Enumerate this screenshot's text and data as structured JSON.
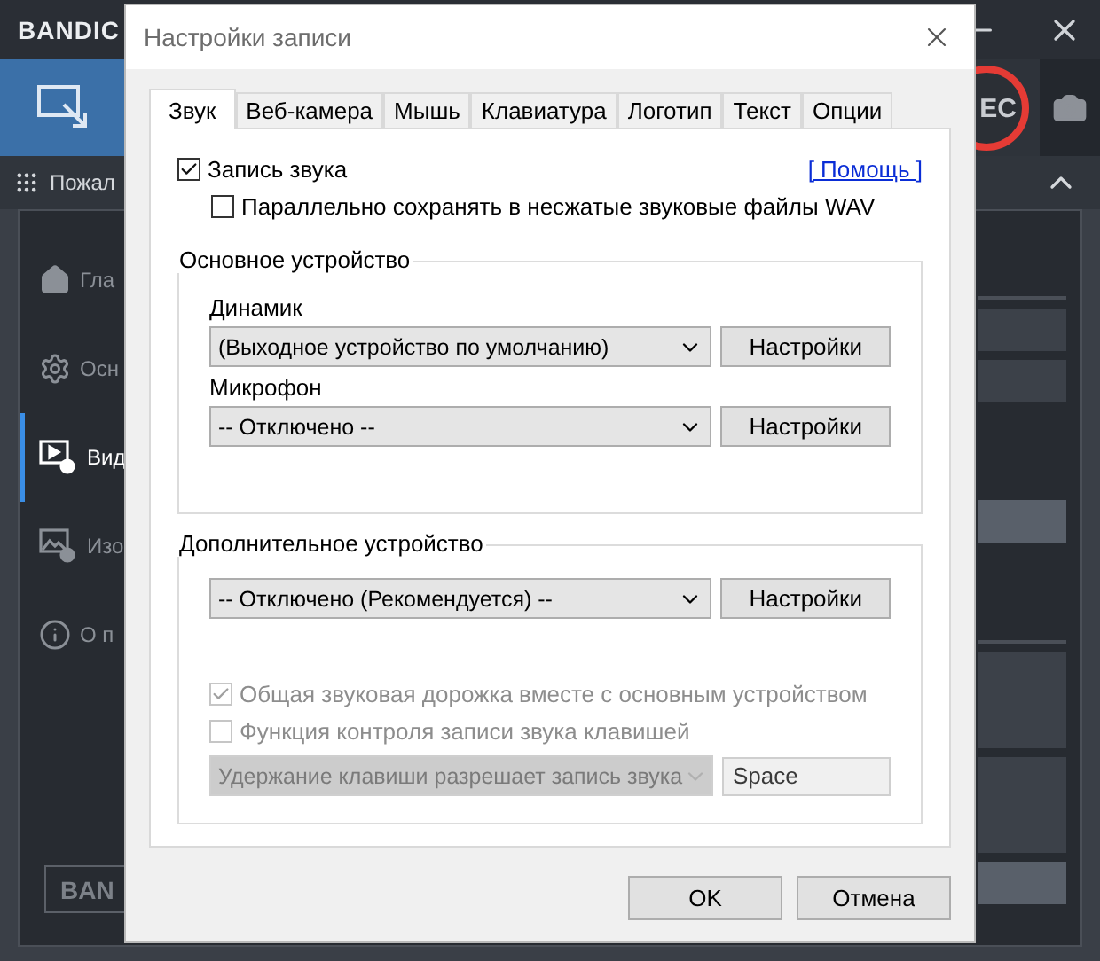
{
  "app": {
    "logo": "BANDIC",
    "rec_label": "EC",
    "section_title": "Пожал",
    "sidebar": [
      {
        "label": "Гла",
        "selected": false
      },
      {
        "label": "Осн",
        "selected": false
      },
      {
        "label": "Вид",
        "selected": true
      },
      {
        "label": "Изо",
        "selected": false
      },
      {
        "label": "О п",
        "selected": false
      }
    ],
    "bottom_button": "BAN"
  },
  "dialog": {
    "title": "Настройки записи",
    "tabs": [
      {
        "label": "Звук",
        "selected": true
      },
      {
        "label": "Веб-камера",
        "selected": false
      },
      {
        "label": "Мышь",
        "selected": false
      },
      {
        "label": "Клавиатура",
        "selected": false
      },
      {
        "label": "Логотип",
        "selected": false
      },
      {
        "label": "Текст",
        "selected": false
      },
      {
        "label": "Опции",
        "selected": false
      }
    ],
    "record_audio": {
      "label": "Запись звука",
      "checked": true
    },
    "help_link": "[ Помощь ]",
    "save_wav": {
      "label": "Параллельно сохранять в несжатые звуковые файлы WAV",
      "checked": false
    },
    "main_group": {
      "title": "Основное устройство",
      "devices": [
        {
          "label": "Динамик",
          "value": "(Выходное устройство по умолчанию)",
          "button": "Настройки"
        },
        {
          "label": "Микрофон",
          "value": "-- Отключено --",
          "button": "Настройки"
        }
      ]
    },
    "extra_group": {
      "title": "Дополнительное устройство",
      "value": "-- Отключено (Рекомендуется) --",
      "button": "Настройки",
      "options": [
        {
          "label": "Общая звуковая дорожка вместе с основным устройством",
          "checked": true,
          "disabled": true
        },
        {
          "label": "Функция контроля записи звука клавишей",
          "checked": false,
          "disabled": true
        }
      ],
      "hotkey_mode": {
        "value": "Удержание клавиши разрешает запись звука",
        "disabled": true
      },
      "hotkey": {
        "value": "Space",
        "disabled": true
      }
    },
    "buttons": [
      "OK",
      "Отмена"
    ]
  }
}
